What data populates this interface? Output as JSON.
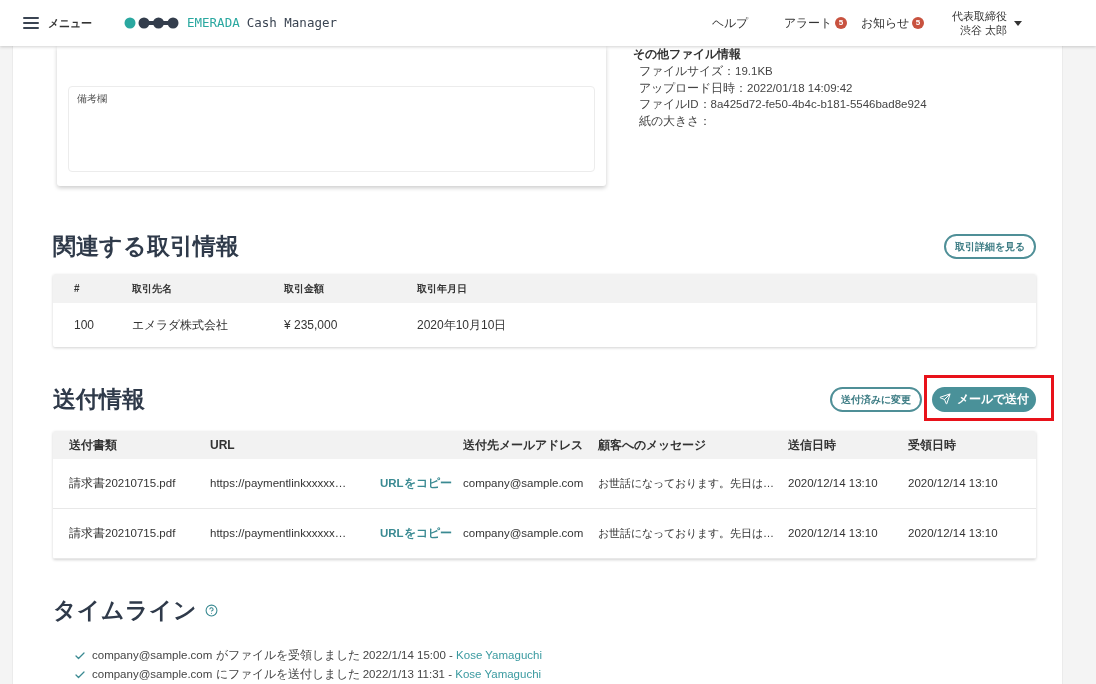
{
  "header": {
    "menu_label": "メニュー",
    "logo": {
      "brand": "EMERADA",
      "product": "Cash Manager"
    },
    "nav": [
      {
        "label": "ヘルプ"
      },
      {
        "label": "アラート",
        "badge": "5"
      },
      {
        "label": "お知らせ",
        "badge": "5"
      }
    ],
    "user": {
      "role": "代表取締役",
      "name": "渋谷 太郎"
    }
  },
  "file_card": {
    "remarks": {
      "label": "備考欄"
    }
  },
  "file_info": {
    "title": "その他ファイル情報",
    "rows": [
      "ファイルサイズ：19.1KB",
      "アップロード日時：2022/01/18 14:09:42",
      "ファイルID：8a425d72-fe50-4b4c-b181-5546bad8e924",
      "紙の大きさ："
    ]
  },
  "related": {
    "title": "関連する取引情報",
    "button": "取引詳細を見る",
    "table": {
      "columns": [
        "#",
        "取引先名",
        "取引金額",
        "取引年月日"
      ],
      "rows": [
        [
          "100",
          "エメラダ株式会社",
          "¥ 235,000",
          "2020年10月10日"
        ]
      ]
    }
  },
  "delivery": {
    "title": "送付情報",
    "buttons": [
      {
        "label": "送付済みに変更",
        "kind": "outline",
        "highlighted": false
      },
      {
        "label": "メールで送付",
        "kind": "primary",
        "highlighted": true
      }
    ],
    "table": {
      "columns": [
        "送付書類",
        "URL",
        "送付先メールアドレス",
        "顧客へのメッセージ",
        "送信日時",
        "受領日時"
      ],
      "rows": [
        {
          "document": "請求書20210715.pdf",
          "url": "https://paymentlinkxxxxx…",
          "copy_link": "URLをコピー",
          "email": "company@sample.com",
          "message": "お世話になっております。先日は…",
          "sent_at": "2020/12/14 13:10",
          "received_at": "2020/12/14 13:10"
        },
        {
          "document": "請求書20210715.pdf",
          "url": "https://paymentlinkxxxxx…",
          "copy_link": "URLをコピー",
          "email": "company@sample.com",
          "message": "お世話になっております。先日は…",
          "sent_at": "2020/12/14 13:10",
          "received_at": "2020/12/14 13:10"
        }
      ]
    }
  },
  "timeline": {
    "title": "タイムライン",
    "entries": [
      {
        "text": "company@sample.com がファイルを受領しました 2022/1/14 15:00 -",
        "user": "Kose Yamaguchi"
      },
      {
        "text": "company@sample.com にファイルを送付しました 2022/1/13 11:31 -",
        "user": "Kose Yamaguchi"
      }
    ]
  }
}
